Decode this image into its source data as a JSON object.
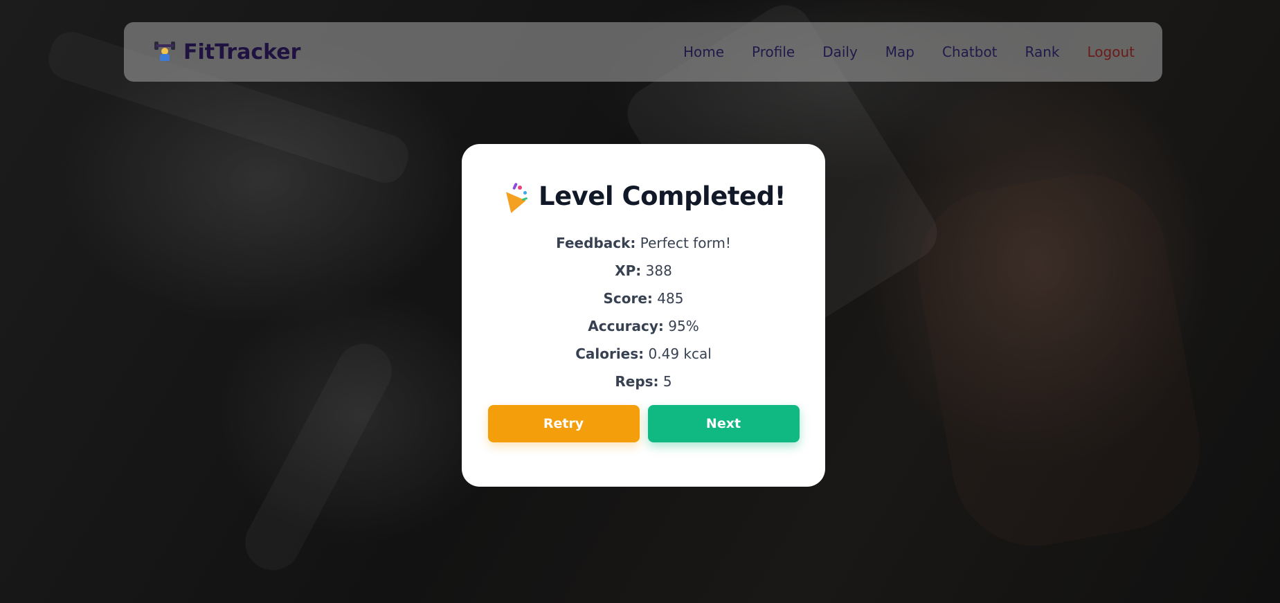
{
  "navbar": {
    "brand": "FitTracker",
    "brand_icon": "weightlifter-icon",
    "links": [
      {
        "label": "Home"
      },
      {
        "label": "Profile"
      },
      {
        "label": "Daily"
      },
      {
        "label": "Map"
      },
      {
        "label": "Chatbot"
      },
      {
        "label": "Rank"
      },
      {
        "label": "Logout"
      }
    ]
  },
  "modal": {
    "icon": "party-popper-icon",
    "title": "Level Completed!",
    "stats": [
      {
        "label": "Feedback:",
        "value": "Perfect form!"
      },
      {
        "label": "XP:",
        "value": "388"
      },
      {
        "label": "Score:",
        "value": "485"
      },
      {
        "label": "Accuracy:",
        "value": "95%"
      },
      {
        "label": "Calories:",
        "value": "0.49 kcal"
      },
      {
        "label": "Reps:",
        "value": "5"
      }
    ],
    "retry_label": "Retry",
    "next_label": "Next"
  },
  "colors": {
    "retry": "#f59e0b",
    "next": "#10b981",
    "brand_text": "#1f1240",
    "logout": "#6b1a1a"
  }
}
